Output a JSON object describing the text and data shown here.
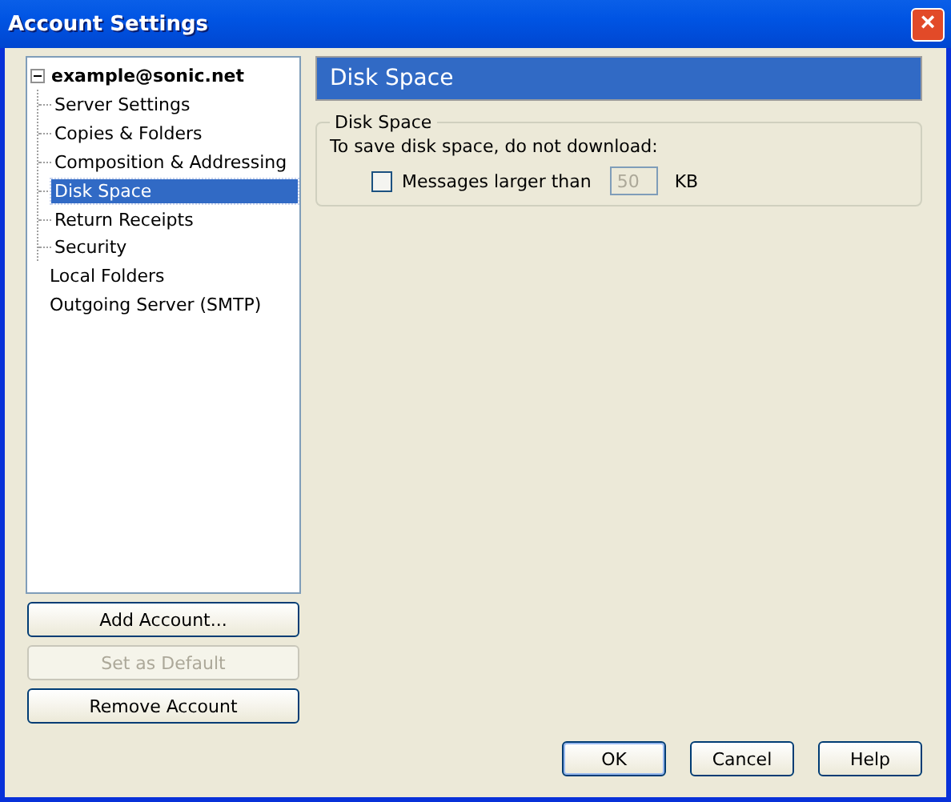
{
  "window": {
    "title": "Account Settings",
    "close": "×"
  },
  "tree": [
    {
      "label": "example@sonic.net",
      "selected": false,
      "expanded": true,
      "children": [
        {
          "label": "Server Settings",
          "selected": false
        },
        {
          "label": "Copies & Folders",
          "selected": false
        },
        {
          "label": "Composition & Addressing",
          "selected": false
        },
        {
          "label": "Disk Space",
          "selected": true
        },
        {
          "label": "Return Receipts",
          "selected": false
        },
        {
          "label": "Security",
          "selected": false
        }
      ]
    },
    {
      "label": "Local Folders",
      "selected": false
    },
    {
      "label": "Outgoing Server (SMTP)",
      "selected": false
    }
  ],
  "account_buttons": [
    {
      "label": "Add Account...",
      "disabled": false
    },
    {
      "label": "Set as Default",
      "disabled": true
    },
    {
      "label": "Remove Account",
      "disabled": false
    }
  ],
  "panel": {
    "title": "Disk Space",
    "group": {
      "legend": "Disk Space",
      "intro": "To save disk space, do not download:",
      "option": {
        "label": "Messages larger than",
        "checked": false,
        "value": "50",
        "unit": "KB",
        "disabled": true
      }
    }
  },
  "buttons": [
    {
      "label": "OK",
      "default": true
    },
    {
      "label": "Cancel",
      "default": false
    },
    {
      "label": "Help",
      "default": false
    }
  ]
}
